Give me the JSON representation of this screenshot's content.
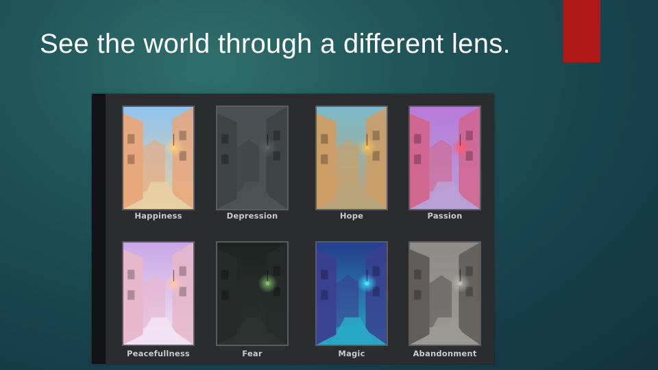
{
  "slide": {
    "title": "See the world through a different lens.",
    "accent_color": "#b01818"
  },
  "gallery": {
    "items": [
      {
        "label": "Happiness",
        "sky": "#8fc3ef",
        "wall": "#e9a77a",
        "ground": "#e8cfa2",
        "glow": "#ffd27a"
      },
      {
        "label": "Depression",
        "sky": "#4a5053",
        "wall": "#3d4245",
        "ground": "#4d5254",
        "glow": "#5b6164"
      },
      {
        "label": "Hope",
        "sky": "#7bb9c9",
        "wall": "#cf9c63",
        "ground": "#b9a37a",
        "glow": "#f3c35d"
      },
      {
        "label": "Passion",
        "sky": "#b67ad8",
        "wall": "#d2658c",
        "ground": "#b9a0d6",
        "glow": "#ff5a6e"
      },
      {
        "label": "Peacefullness",
        "sky": "#c9a7e6",
        "wall": "#e7b6c9",
        "ground": "#f2e3f2",
        "glow": "#ffc9a8"
      },
      {
        "label": "Fear",
        "sky": "#1e2422",
        "wall": "#262b29",
        "ground": "#2b3230",
        "glow": "#7fbf6a"
      },
      {
        "label": "Magic",
        "sky": "#243d8c",
        "wall": "#3a3f8f",
        "ground": "#2aa7c7",
        "glow": "#3fe6ff"
      },
      {
        "label": "Abandonment",
        "sky": "#8f8b88",
        "wall": "#5e5a57",
        "ground": "#9c9894",
        "glow": "#bdb8b3"
      }
    ]
  }
}
